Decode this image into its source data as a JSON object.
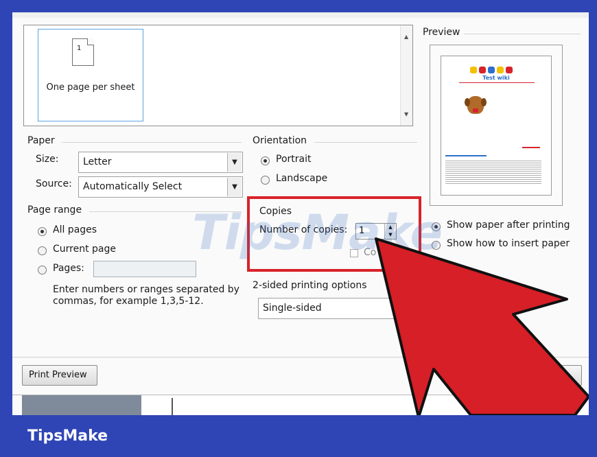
{
  "layout_panel": {
    "pages_per_sheet_label": "One page per sheet",
    "page_number": "1"
  },
  "paper": {
    "heading": "Paper",
    "size_label": "Size:",
    "size_value": "Letter",
    "source_label": "Source:",
    "source_value": "Automatically Select"
  },
  "orientation": {
    "heading": "Orientation",
    "portrait": "Portrait",
    "landscape": "Landscape",
    "selected": "Portrait"
  },
  "page_range": {
    "heading": "Page range",
    "all_pages": "All pages",
    "current_page": "Current page",
    "pages": "Pages:",
    "help_line1": "Enter numbers or ranges separated by",
    "help_line2": "commas, for example 1,3,5-12."
  },
  "copies": {
    "heading": "Copies",
    "number_label": "Number of copies:",
    "number_value": "1",
    "collate_label": "Co"
  },
  "two_sided": {
    "heading": "2-sided printing options",
    "value": "Single-sided"
  },
  "preview": {
    "heading": "Preview",
    "doc_title": "Test wiki",
    "show_after": "Show paper after printing",
    "show_insert": "Show how to insert paper"
  },
  "buttons": {
    "print_preview": "Print Preview"
  },
  "watermark": "TipsMake",
  "footer_brand": "TipsMake",
  "colors": {
    "frame_blue": "#2f45b5",
    "highlight_red": "#d8232a",
    "arrow_red": "#d61f26"
  }
}
